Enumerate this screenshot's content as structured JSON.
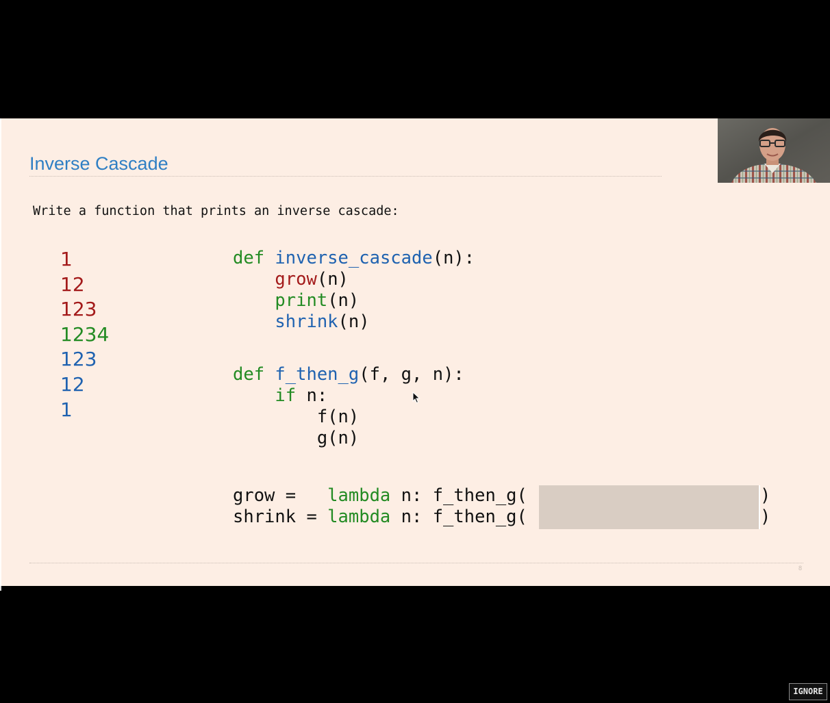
{
  "slide": {
    "title": "Inverse Cascade",
    "prompt": "Write a function that prints an inverse cascade:",
    "page_number": "8",
    "cascade": [
      {
        "text": "1",
        "color": "#a31a1a"
      },
      {
        "text": "12",
        "color": "#a31a1a"
      },
      {
        "text": "123",
        "color": "#a31a1a"
      },
      {
        "text": "1234",
        "color": "#238b23"
      },
      {
        "text": "123",
        "color": "#1f62b0"
      },
      {
        "text": "12",
        "color": "#1f62b0"
      },
      {
        "text": "1",
        "color": "#1f62b0"
      }
    ],
    "code": {
      "inverse_cascade": {
        "signature": [
          {
            "text": "def",
            "color": "#238b23"
          },
          {
            "text": " ",
            "color": "#111111"
          },
          {
            "text": "inverse_cascade",
            "color": "#1f62b0"
          },
          {
            "text": "(n):",
            "color": "#111111"
          }
        ],
        "body": [
          [
            {
              "text": "    ",
              "color": "#111111"
            },
            {
              "text": "grow",
              "color": "#a31a1a"
            },
            {
              "text": "(n)",
              "color": "#111111"
            }
          ],
          [
            {
              "text": "    ",
              "color": "#111111"
            },
            {
              "text": "print",
              "color": "#238b23"
            },
            {
              "text": "(n)",
              "color": "#111111"
            }
          ],
          [
            {
              "text": "    ",
              "color": "#111111"
            },
            {
              "text": "shrink",
              "color": "#1f62b0"
            },
            {
              "text": "(n)",
              "color": "#111111"
            }
          ]
        ]
      },
      "f_then_g": {
        "signature": [
          {
            "text": "def",
            "color": "#238b23"
          },
          {
            "text": " ",
            "color": "#111111"
          },
          {
            "text": "f_then_g",
            "color": "#1f62b0"
          },
          {
            "text": "(f, g, n):",
            "color": "#111111"
          }
        ],
        "body": [
          [
            {
              "text": "    ",
              "color": "#111111"
            },
            {
              "text": "if",
              "color": "#238b23"
            },
            {
              "text": " n:",
              "color": "#111111"
            }
          ],
          [
            {
              "text": "        f(n)",
              "color": "#111111"
            }
          ],
          [
            {
              "text": "        g(n)",
              "color": "#111111"
            }
          ]
        ]
      },
      "grow_line": [
        {
          "text": "grow =   ",
          "color": "#111111"
        },
        {
          "text": "lambda",
          "color": "#238b23"
        },
        {
          "text": " n: f_then_g(",
          "color": "#111111"
        }
      ],
      "shrink_line": [
        {
          "text": "shrink = ",
          "color": "#111111"
        },
        {
          "text": "lambda",
          "color": "#238b23"
        },
        {
          "text": " n: f_then_g(",
          "color": "#111111"
        }
      ],
      "closing_paren": ")"
    },
    "colors": {
      "background": "#fdeee4",
      "title": "#2f7fc4",
      "blank_box": "#d9cdc3"
    }
  },
  "webcam": {
    "icon": "presenter-webcam"
  },
  "overlay": {
    "ignore_label": "IGNORE"
  }
}
